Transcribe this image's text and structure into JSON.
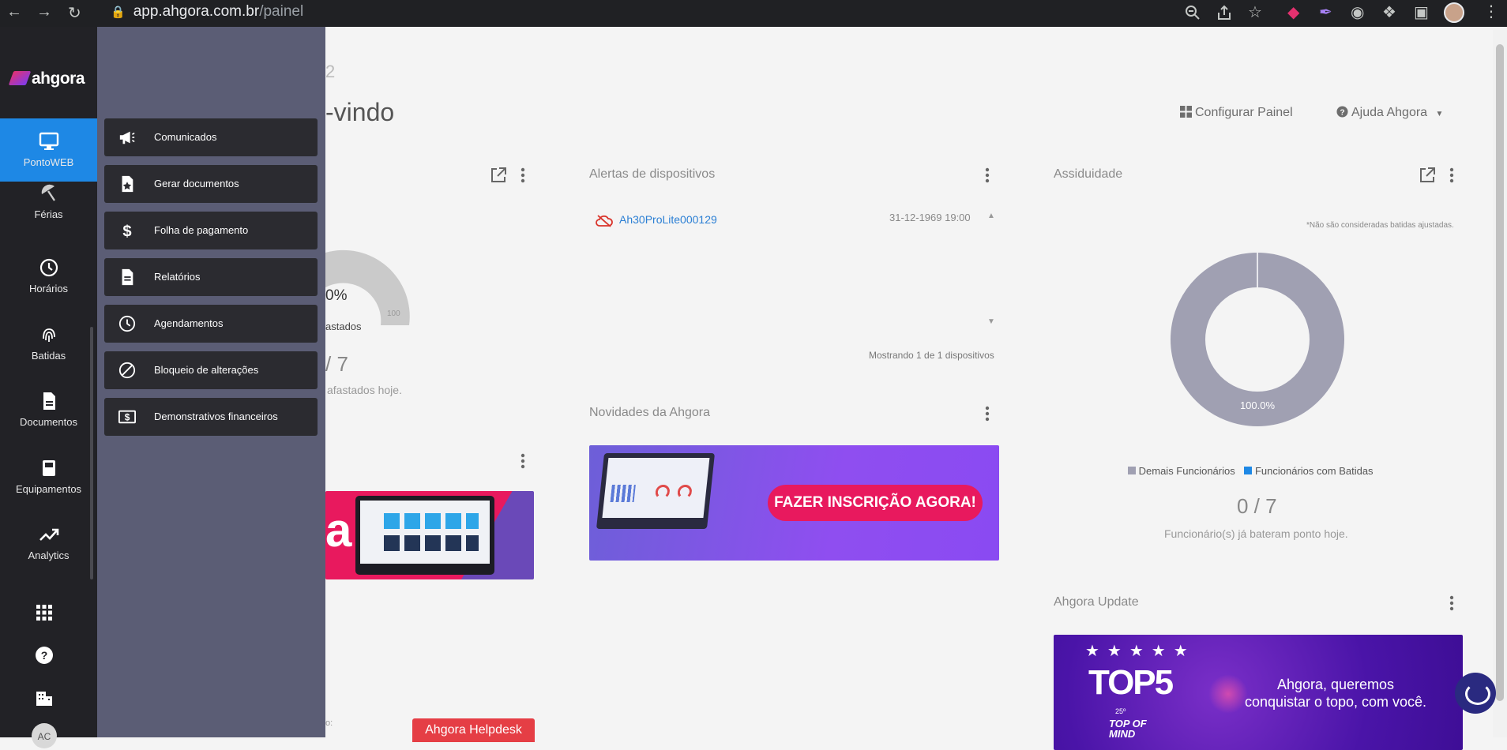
{
  "browser": {
    "url_domain": "app.ahgora.com.br",
    "url_path": "/painel"
  },
  "rail": {
    "logo_text": "ahgora",
    "items": [
      {
        "label": "PontoWEB",
        "icon": "monitor-icon"
      },
      {
        "label": "Férias",
        "icon": "beach-umbrella-icon"
      },
      {
        "label": "Horários",
        "icon": "clock-icon"
      },
      {
        "label": "Batidas",
        "icon": "fingerprint-icon"
      },
      {
        "label": "Documentos",
        "icon": "document-icon"
      },
      {
        "label": "Equipamentos",
        "icon": "device-icon"
      },
      {
        "label": "Analytics",
        "icon": "trend-icon"
      }
    ],
    "bottom_icons": [
      "apps-grid-icon",
      "help-icon",
      "building-icon"
    ],
    "avatar_initials": "AC"
  },
  "submenu": {
    "items": [
      {
        "label": "Comunicados",
        "icon": "megaphone-icon"
      },
      {
        "label": "Gerar documentos",
        "icon": "document-star-icon"
      },
      {
        "label": "Folha de pagamento",
        "icon": "dollar-icon"
      },
      {
        "label": "Relatórios",
        "icon": "report-icon"
      },
      {
        "label": "Agendamentos",
        "icon": "clock-icon"
      },
      {
        "label": "Bloqueio de alterações",
        "icon": "block-icon"
      },
      {
        "label": "Demonstrativos financeiros",
        "icon": "money-statement-icon"
      }
    ]
  },
  "main": {
    "partial_heading": "2",
    "welcome_partial": "-vindo",
    "toolbar": {
      "configure_label": "Configurar Painel",
      "help_label": "Ajuda Ahgora"
    },
    "left_card": {
      "gauge_percent": "0%",
      "gauge_max": "100",
      "legend_partial": "astados",
      "count_partial": "/ 7",
      "caption_partial": "afastados hoje.",
      "label_partial": "o:"
    },
    "alerts": {
      "title": "Alertas de dispositivos",
      "device_name": "Ah30ProLite000129",
      "device_date": "31-12-1969 19:00",
      "footer": "Mostrando 1 de 1 dispositivos"
    },
    "news": {
      "title": "Novidades da Ahgora",
      "cta": "FAZER INSCRIÇÃO AGORA!"
    },
    "assiduidade": {
      "title": "Assiduidade",
      "note": "*Não são consideradas batidas ajustadas.",
      "donut_label": "100.0%",
      "legend": [
        {
          "label": "Demais Funcionários",
          "color": "#a0a0b2"
        },
        {
          "label": "Funcionários com Batidas",
          "color": "#1e88e5"
        }
      ],
      "count": "0 / 7",
      "caption": "Funcionário(s) já bateram ponto hoje."
    },
    "update": {
      "title": "Ahgora Update",
      "top_text": "TOP5",
      "message_line1": "Ahgora, queremos",
      "message_line2": "conquistar o topo, com você.",
      "badge_text": "TOP OF MIND",
      "badge_year": "25º"
    },
    "helpdesk_label": "Ahgora Helpdesk"
  }
}
